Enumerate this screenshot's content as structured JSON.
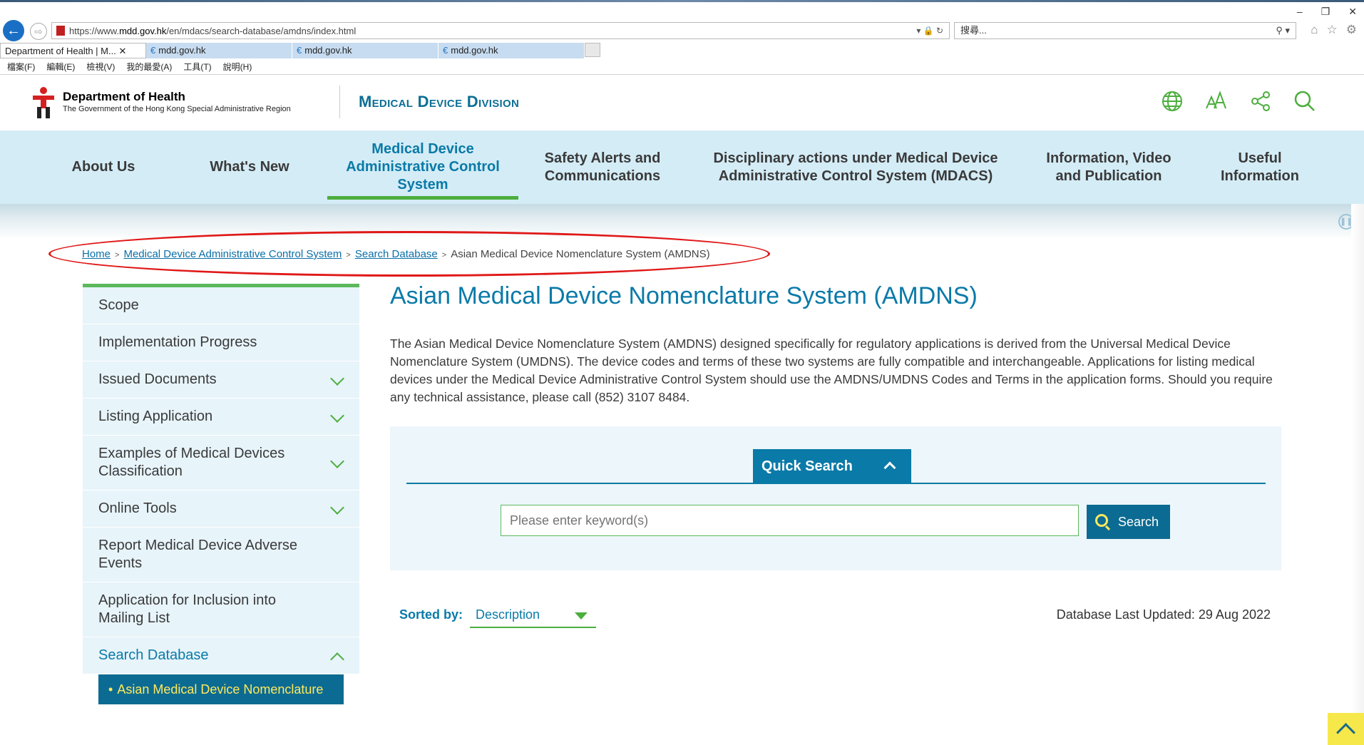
{
  "browser": {
    "url_prefix": "https://www.",
    "url_host": "mdd.gov.hk",
    "url_path": "/en/mdacs/search-database/amdns/index.html",
    "search_placeholder": "搜尋...",
    "tabs": [
      {
        "label": "Department of Health | M...",
        "active": true
      },
      {
        "label": "mdd.gov.hk",
        "active": false
      },
      {
        "label": "mdd.gov.hk",
        "active": false
      },
      {
        "label": "mdd.gov.hk",
        "active": false
      }
    ],
    "menu": [
      "檔案(F)",
      "編輯(E)",
      "檢視(V)",
      "我的最愛(A)",
      "工具(T)",
      "說明(H)"
    ],
    "window_controls": [
      "–",
      "❐",
      "✕"
    ]
  },
  "header": {
    "dept_title": "Department of Health",
    "dept_subtitle": "The Government of the Hong Kong Special Administrative Region",
    "division": "Medical Device Division",
    "icons": [
      "globe-icon",
      "font-size-icon",
      "share-icon",
      "search-icon"
    ]
  },
  "nav": {
    "items": [
      {
        "label": "About Us",
        "active": false
      },
      {
        "label": "What's New",
        "active": false
      },
      {
        "label": "Medical Device Administrative Control System",
        "active": true
      },
      {
        "label": "Safety Alerts and Communications",
        "active": false
      },
      {
        "label": "Disciplinary actions under Medical Device Administrative Control System (MDACS)",
        "active": false
      },
      {
        "label": "Information, Video and Publication",
        "active": false
      },
      {
        "label": "Useful Information",
        "active": false
      }
    ]
  },
  "breadcrumb": {
    "items": [
      "Home",
      "Medical Device Administrative Control System",
      "Search Database"
    ],
    "current": "Asian Medical Device Nomenclature System (AMDNS)",
    "separator": ">"
  },
  "sidebar": {
    "items": [
      {
        "label": "Scope",
        "expandable": false
      },
      {
        "label": "Implementation Progress",
        "expandable": false
      },
      {
        "label": "Issued Documents",
        "expandable": true
      },
      {
        "label": "Listing Application",
        "expandable": true
      },
      {
        "label": "Examples of Medical Devices Classification",
        "expandable": true
      },
      {
        "label": "Online Tools",
        "expandable": true
      },
      {
        "label": "Report Medical Device Adverse Events",
        "expandable": false
      },
      {
        "label": "Application for Inclusion into Mailing List",
        "expandable": false
      },
      {
        "label": "Search Database",
        "expandable": true,
        "open": true
      }
    ],
    "subitem": "Asian Medical Device Nomenclature"
  },
  "main": {
    "title": "Asian Medical Device Nomenclature System (AMDNS)",
    "description": "The Asian Medical Device Nomenclature System (AMDNS) designed specifically for regulatory applications is derived from the Universal Medical Device Nomenclature System (UMDNS). The device codes and terms of these two systems are fully compatible and interchangeable. Applications for listing medical devices under the Medical Device Administrative Control System should use the AMDNS/UMDNS Codes and Terms in the application forms. Should you require any technical assistance, please call (852) 3107 8484.",
    "quick_search_label": "Quick Search",
    "keyword_placeholder": "Please enter keyword(s)",
    "search_button": "Search",
    "sorted_by_label": "Sorted by:",
    "sorted_by_value": "Description",
    "db_updated": "Database Last Updated: 29 Aug 2022"
  },
  "colors": {
    "accent_blue": "#0a7aa8",
    "accent_green": "#4cae3d",
    "nav_bg": "#d4ecf6",
    "highlight_yellow": "#ffe95e",
    "annotation_red": "#e01818"
  }
}
